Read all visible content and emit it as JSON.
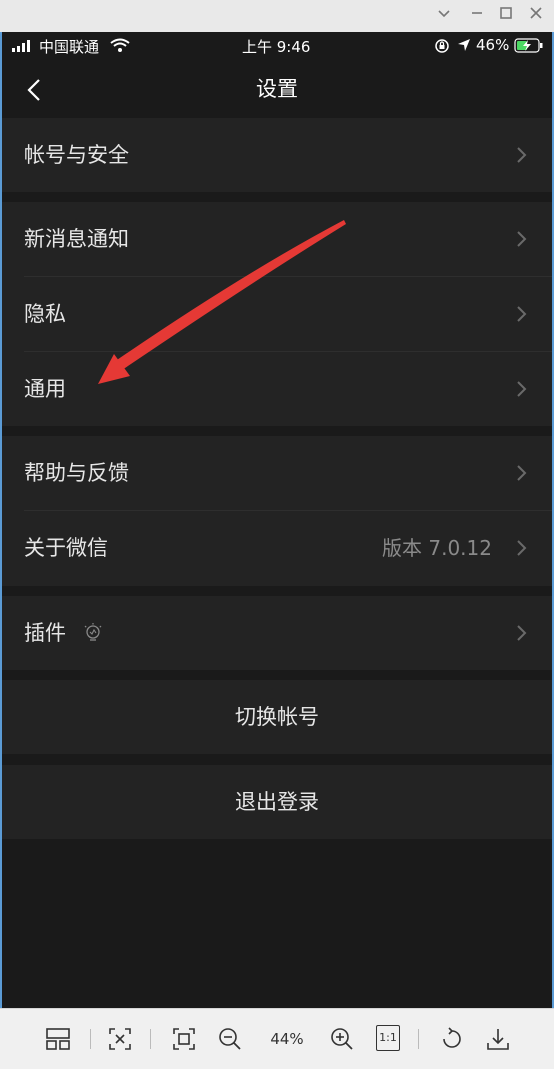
{
  "status": {
    "carrier": "中国联通",
    "time": "上午 9:46",
    "battery": "46%"
  },
  "nav": {
    "title": "设置"
  },
  "rows": {
    "account": "帐号与安全",
    "notify": "新消息通知",
    "privacy": "隐私",
    "general": "通用",
    "help": "帮助与反馈",
    "about": "关于微信",
    "about_value": "版本 7.0.12",
    "plugins": "插件"
  },
  "actions": {
    "switch": "切换帐号",
    "logout": "退出登录"
  },
  "toolbar": {
    "zoom": "44%",
    "one_to_one": "1:1"
  },
  "colors": {
    "bg": "#1a1a1a",
    "cell": "#232323",
    "text": "#e6e6e6",
    "annotation": "#e53935"
  }
}
